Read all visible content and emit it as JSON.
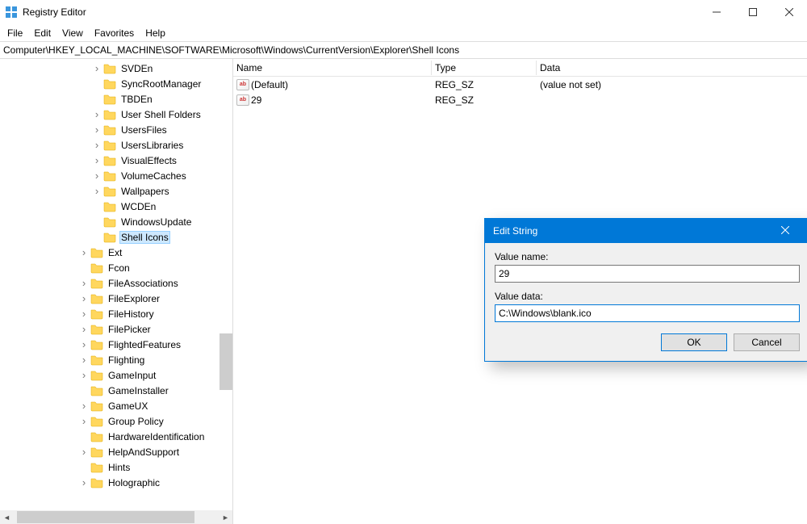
{
  "app": {
    "title": "Registry Editor"
  },
  "menu": {
    "file": "File",
    "edit": "Edit",
    "view": "View",
    "favorites": "Favorites",
    "help": "Help"
  },
  "address": "Computer\\HKEY_LOCAL_MACHINE\\SOFTWARE\\Microsoft\\Windows\\CurrentVersion\\Explorer\\Shell Icons",
  "tree": [
    {
      "indent": 7,
      "exp": ">",
      "label": "SVDEn"
    },
    {
      "indent": 7,
      "exp": "",
      "label": "SyncRootManager"
    },
    {
      "indent": 7,
      "exp": "",
      "label": "TBDEn"
    },
    {
      "indent": 7,
      "exp": ">",
      "label": "User Shell Folders"
    },
    {
      "indent": 7,
      "exp": ">",
      "label": "UsersFiles"
    },
    {
      "indent": 7,
      "exp": ">",
      "label": "UsersLibraries"
    },
    {
      "indent": 7,
      "exp": ">",
      "label": "VisualEffects"
    },
    {
      "indent": 7,
      "exp": ">",
      "label": "VolumeCaches"
    },
    {
      "indent": 7,
      "exp": ">",
      "label": "Wallpapers"
    },
    {
      "indent": 7,
      "exp": "",
      "label": "WCDEn"
    },
    {
      "indent": 7,
      "exp": "",
      "label": "WindowsUpdate"
    },
    {
      "indent": 7,
      "exp": "",
      "label": "Shell Icons",
      "selected": true
    },
    {
      "indent": 6,
      "exp": ">",
      "label": "Ext"
    },
    {
      "indent": 6,
      "exp": "",
      "label": "Fcon"
    },
    {
      "indent": 6,
      "exp": ">",
      "label": "FileAssociations"
    },
    {
      "indent": 6,
      "exp": ">",
      "label": "FileExplorer"
    },
    {
      "indent": 6,
      "exp": ">",
      "label": "FileHistory"
    },
    {
      "indent": 6,
      "exp": ">",
      "label": "FilePicker"
    },
    {
      "indent": 6,
      "exp": ">",
      "label": "FlightedFeatures"
    },
    {
      "indent": 6,
      "exp": ">",
      "label": "Flighting"
    },
    {
      "indent": 6,
      "exp": ">",
      "label": "GameInput"
    },
    {
      "indent": 6,
      "exp": "",
      "label": "GameInstaller"
    },
    {
      "indent": 6,
      "exp": ">",
      "label": "GameUX"
    },
    {
      "indent": 6,
      "exp": ">",
      "label": "Group Policy"
    },
    {
      "indent": 6,
      "exp": "",
      "label": "HardwareIdentification"
    },
    {
      "indent": 6,
      "exp": ">",
      "label": "HelpAndSupport"
    },
    {
      "indent": 6,
      "exp": "",
      "label": "Hints"
    },
    {
      "indent": 6,
      "exp": ">",
      "label": "Holographic"
    }
  ],
  "list": {
    "cols": {
      "name": "Name",
      "type": "Type",
      "data": "Data"
    },
    "rows": [
      {
        "name": "(Default)",
        "type": "REG_SZ",
        "data": "(value not set)"
      },
      {
        "name": "29",
        "type": "REG_SZ",
        "data": ""
      }
    ]
  },
  "dialog": {
    "title": "Edit String",
    "valueNameLabel": "Value name:",
    "valueName": "29",
    "valueDataLabel": "Value data:",
    "valueData": "C:\\Windows\\blank.ico",
    "ok": "OK",
    "cancel": "Cancel"
  }
}
